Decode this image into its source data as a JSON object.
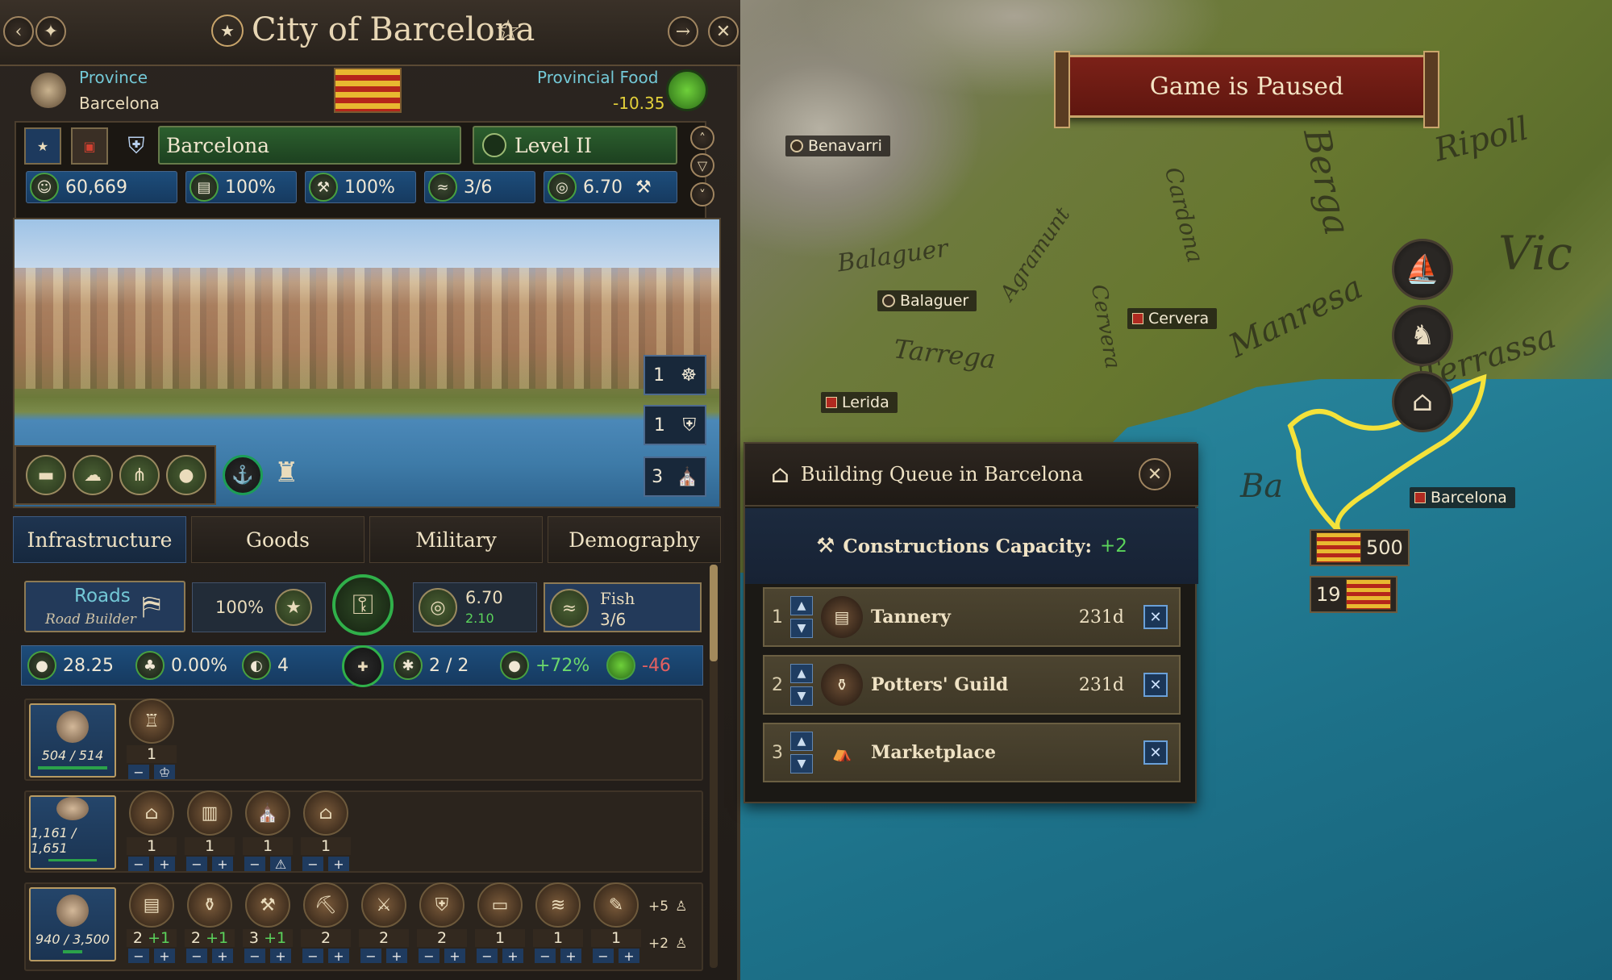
{
  "header": {
    "title": "City of Barcelona",
    "back_icon": "back-arrow-icon",
    "settings_icon": "compass-icon",
    "goto_icon": "goto-arrow-icon",
    "close_icon": "close-icon"
  },
  "province": {
    "label": "Province",
    "name": "Barcelona",
    "food_label": "Provincial Food",
    "food_value": "-10.35"
  },
  "city_bar": {
    "name": "Barcelona",
    "level": "Level II"
  },
  "stats": {
    "population": "60,669",
    "stat2": "100%",
    "stat3": "100%",
    "stat4": "3/6",
    "stat5": "6.70"
  },
  "vista_counters": [
    "1",
    "1",
    "3"
  ],
  "tabs": [
    "Infrastructure",
    "Goods",
    "Military",
    "Demography"
  ],
  "infra": {
    "roads_label": "Roads",
    "roads_sub": "Road Builder",
    "pct": "100%",
    "coins": "6.70",
    "coins_sub": "2.10",
    "fish_label": "Fish",
    "fish_value": "3/6"
  },
  "metrics": {
    "m1": "28.25",
    "m2": "0.00%",
    "m3": "4",
    "m4": "2 / 2",
    "m5": "+72%",
    "m6": "-46"
  },
  "pop_rows": [
    {
      "pop": "504",
      "cap": "514",
      "buildings": [
        {
          "count": "1"
        }
      ]
    },
    {
      "pop": "1,161",
      "cap": "1,651",
      "buildings": [
        {
          "count": "1"
        },
        {
          "count": "1"
        },
        {
          "count": "1"
        },
        {
          "count": "1"
        }
      ]
    },
    {
      "pop": "940",
      "cap": "3,500",
      "buildings": [
        {
          "count": "2",
          "plus": "+1"
        },
        {
          "count": "2",
          "plus": "+1"
        },
        {
          "count": "3",
          "plus": "+1"
        },
        {
          "count": "2"
        },
        {
          "count": "2"
        },
        {
          "count": "2"
        },
        {
          "count": "1"
        },
        {
          "count": "1"
        },
        {
          "count": "1"
        }
      ],
      "extra1": "+5",
      "extra2": "+2"
    }
  ],
  "map": {
    "paused": "Game is Paused",
    "cities": [
      "Benavarri",
      "Balaguer",
      "Cervera",
      "Lerida",
      "Barcelona"
    ],
    "regions": [
      "Balaguer",
      "Tarrega",
      "Berga",
      "Ripoll",
      "Manresa",
      "Terrassa",
      "Vic",
      "Cardona",
      "Agramunt",
      "Cervera",
      "Ba"
    ],
    "army_value": "500",
    "army2_value": "19"
  },
  "queue": {
    "title": "Building Queue in Barcelona",
    "capacity_label": "Constructions Capacity:",
    "capacity_value": "+2",
    "items": [
      {
        "num": "1",
        "name": "Tannery",
        "days": "231d"
      },
      {
        "num": "2",
        "name": "Potters' Guild",
        "days": "231d"
      },
      {
        "num": "3",
        "name": "Marketplace",
        "days": ""
      }
    ]
  },
  "colors": {
    "accent_green": "#2c5f2e",
    "accent_blue": "#1d4d7b",
    "gold_border": "#b79a62",
    "yellow_text": "#e4d13a"
  }
}
